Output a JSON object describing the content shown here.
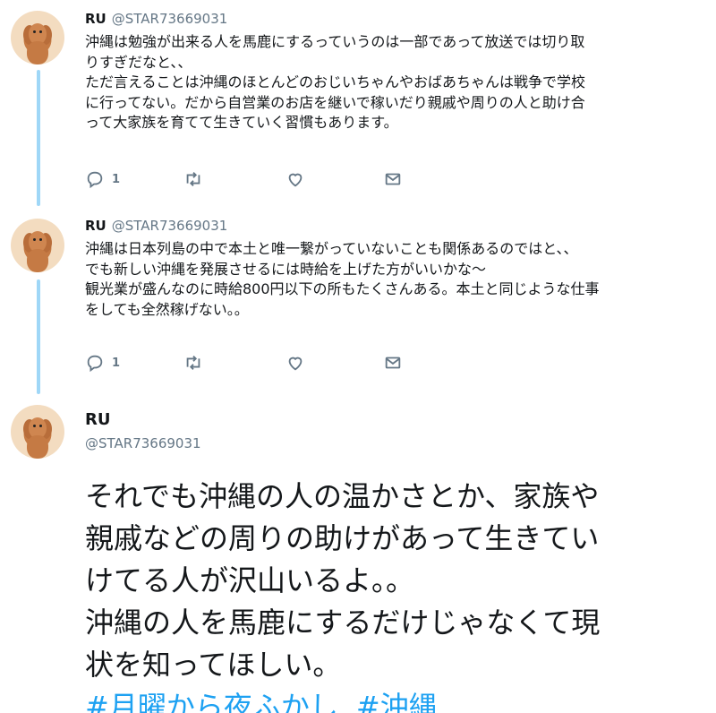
{
  "tweets": [
    {
      "name": "RU",
      "handle": "@STAR73669031",
      "lines": [
        "沖縄は勉強が出来る人を馬鹿にするっていうのは一部であって放送では切り取",
        "りすぎだなと、、",
        "ただ言えることは沖縄のほとんどのおじいちゃんやおばあちゃんは戦争で学校",
        "に行ってない。だから自営業のお店を継いで稼いだり親戚や周りの人と助け合",
        "って大家族を育てて生きていく習慣もあります。"
      ],
      "reply_count": "1"
    },
    {
      "name": "RU",
      "handle": "@STAR73669031",
      "lines": [
        "沖縄は日本列島の中で本土と唯一繋がっていないことも関係あるのではと、、",
        "でも新しい沖縄を発展させるには時給を上げた方がいいかな〜",
        "観光業が盛んなのに時給800円以下の所もたくさんある。本土と同じような仕事",
        "をしても全然稼げない。。"
      ],
      "reply_count": "1"
    }
  ],
  "main_tweet": {
    "name": "RU",
    "handle": "@STAR73669031",
    "lines": [
      "それでも沖縄の人の温かさとか、家族や",
      "親戚などの周りの助けがあって生きてい",
      "けてる人が沢山いるよ。。",
      "沖縄の人を馬鹿にするだけじゃなくて現",
      "状を知ってほしい。"
    ],
    "hashtags": [
      "#月曜から夜ふかし",
      "#沖縄"
    ]
  },
  "icons": {
    "reply": "reply-icon",
    "retweet": "retweet-icon",
    "like": "heart-icon",
    "dm": "envelope-icon"
  },
  "colors": {
    "thread_line": "#9fd7f7",
    "hashtag": "#1da1f2",
    "secondary_text": "#657786"
  }
}
